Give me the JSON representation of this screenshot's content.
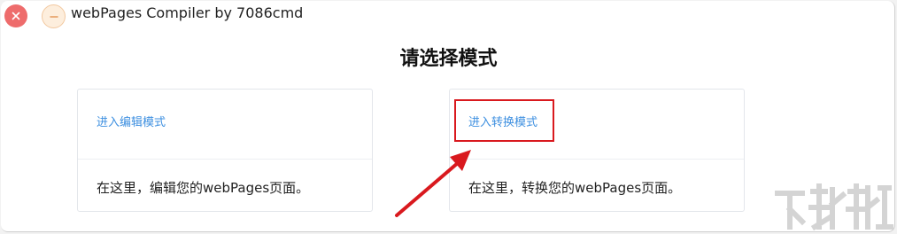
{
  "window": {
    "title": "webPages Compiler by 7086cmd",
    "close_icon": "close-icon",
    "minimize_icon": "minimize-icon"
  },
  "main": {
    "heading": "请选择模式",
    "cards": [
      {
        "link": "进入编辑模式",
        "description": "在这里，编辑您的webPages页面。"
      },
      {
        "link": "进入转换模式",
        "description": "在这里，转换您的webPages页面。"
      }
    ]
  },
  "annotation": {
    "highlight_color": "#d9191e",
    "arrow_icon": "arrow-icon"
  },
  "colors": {
    "link": "#3d8fe0",
    "close": "#ee6c6c"
  }
}
